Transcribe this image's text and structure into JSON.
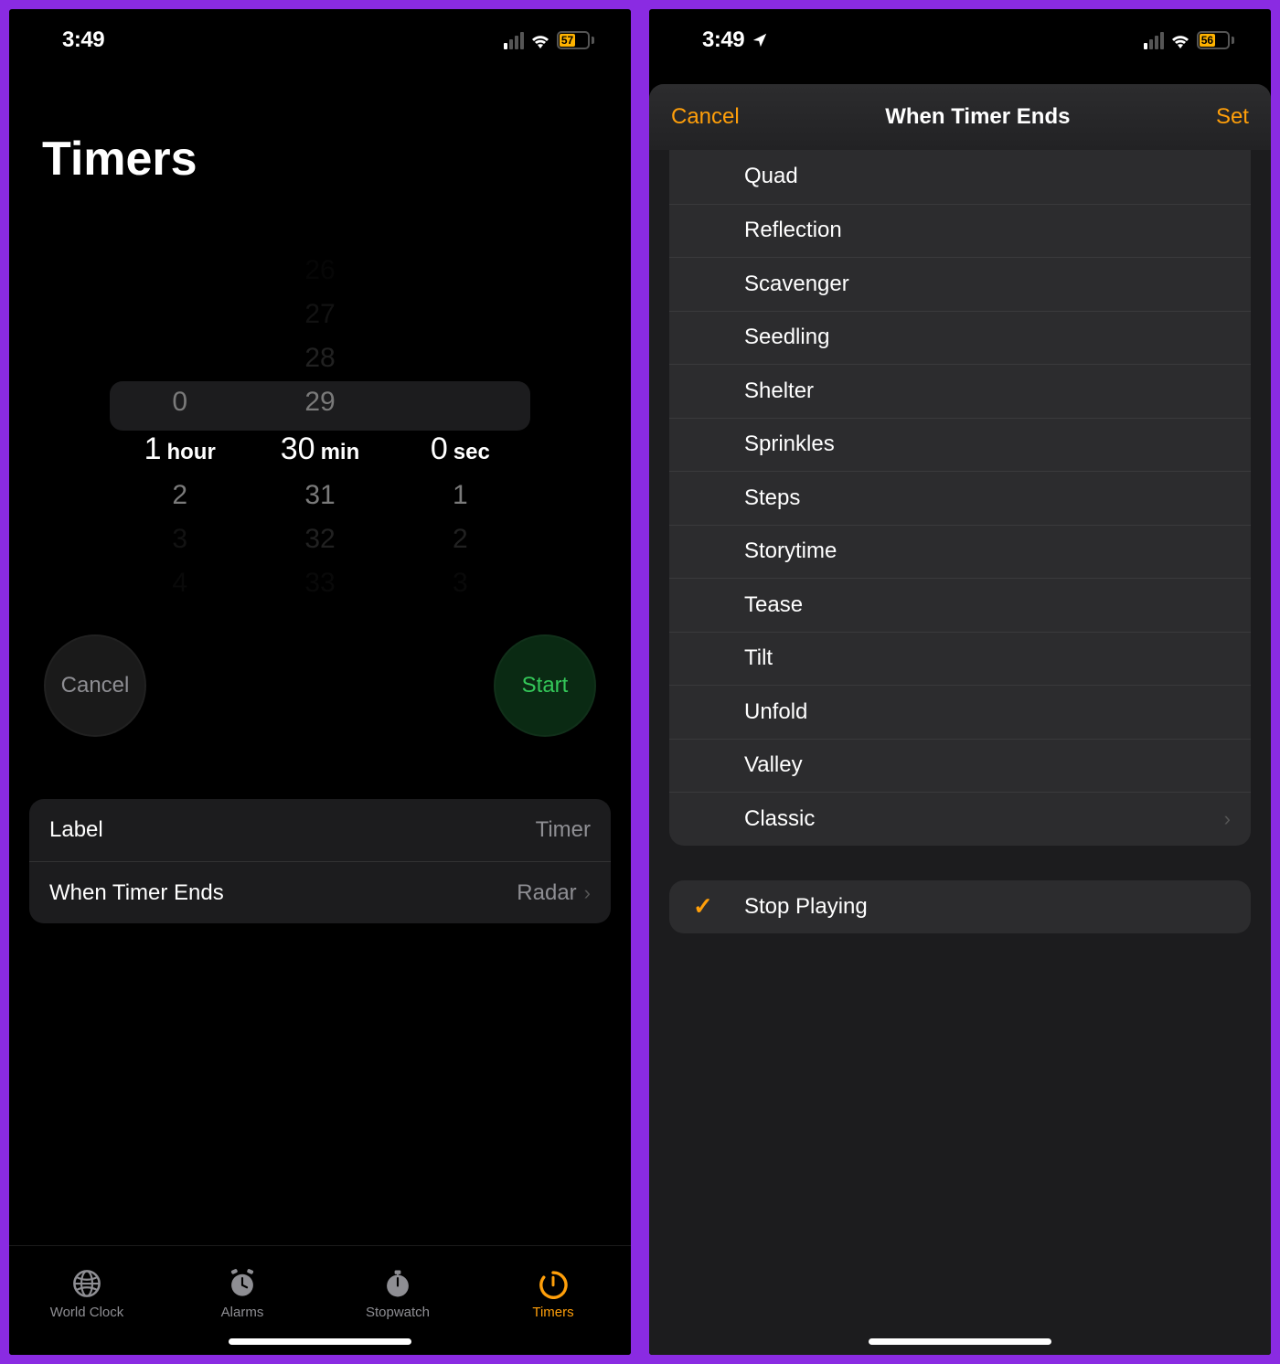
{
  "left": {
    "status": {
      "time": "3:49",
      "battery": "57"
    },
    "title": "Timers",
    "picker": {
      "hours": {
        "above2": "",
        "above1": "0",
        "sel_num": "1",
        "sel_unit": "hour",
        "below1": "2",
        "below2": "3",
        "below3": "4"
      },
      "minutes": {
        "above4": "26",
        "above3": "27",
        "above2": "28",
        "above1": "29",
        "sel_num": "30",
        "sel_unit": "min",
        "below1": "31",
        "below2": "32",
        "below3": "33"
      },
      "seconds": {
        "above1": "",
        "sel_num": "0",
        "sel_unit": "sec",
        "below1": "1",
        "below2": "2",
        "below3": "3"
      }
    },
    "buttons": {
      "cancel": "Cancel",
      "start": "Start"
    },
    "settings": {
      "label_key": "Label",
      "label_val": "Timer",
      "ends_key": "When Timer Ends",
      "ends_val": "Radar"
    },
    "tabs": {
      "world": "World Clock",
      "alarms": "Alarms",
      "stopwatch": "Stopwatch",
      "timers": "Timers"
    }
  },
  "right": {
    "status": {
      "time": "3:49",
      "battery": "56"
    },
    "header": {
      "cancel": "Cancel",
      "title": "When Timer Ends",
      "set": "Set"
    },
    "sounds": [
      "Quad",
      "Reflection",
      "Scavenger",
      "Seedling",
      "Shelter",
      "Sprinkles",
      "Steps",
      "Storytime",
      "Tease",
      "Tilt",
      "Unfold",
      "Valley",
      "Classic"
    ],
    "stop": "Stop Playing"
  }
}
